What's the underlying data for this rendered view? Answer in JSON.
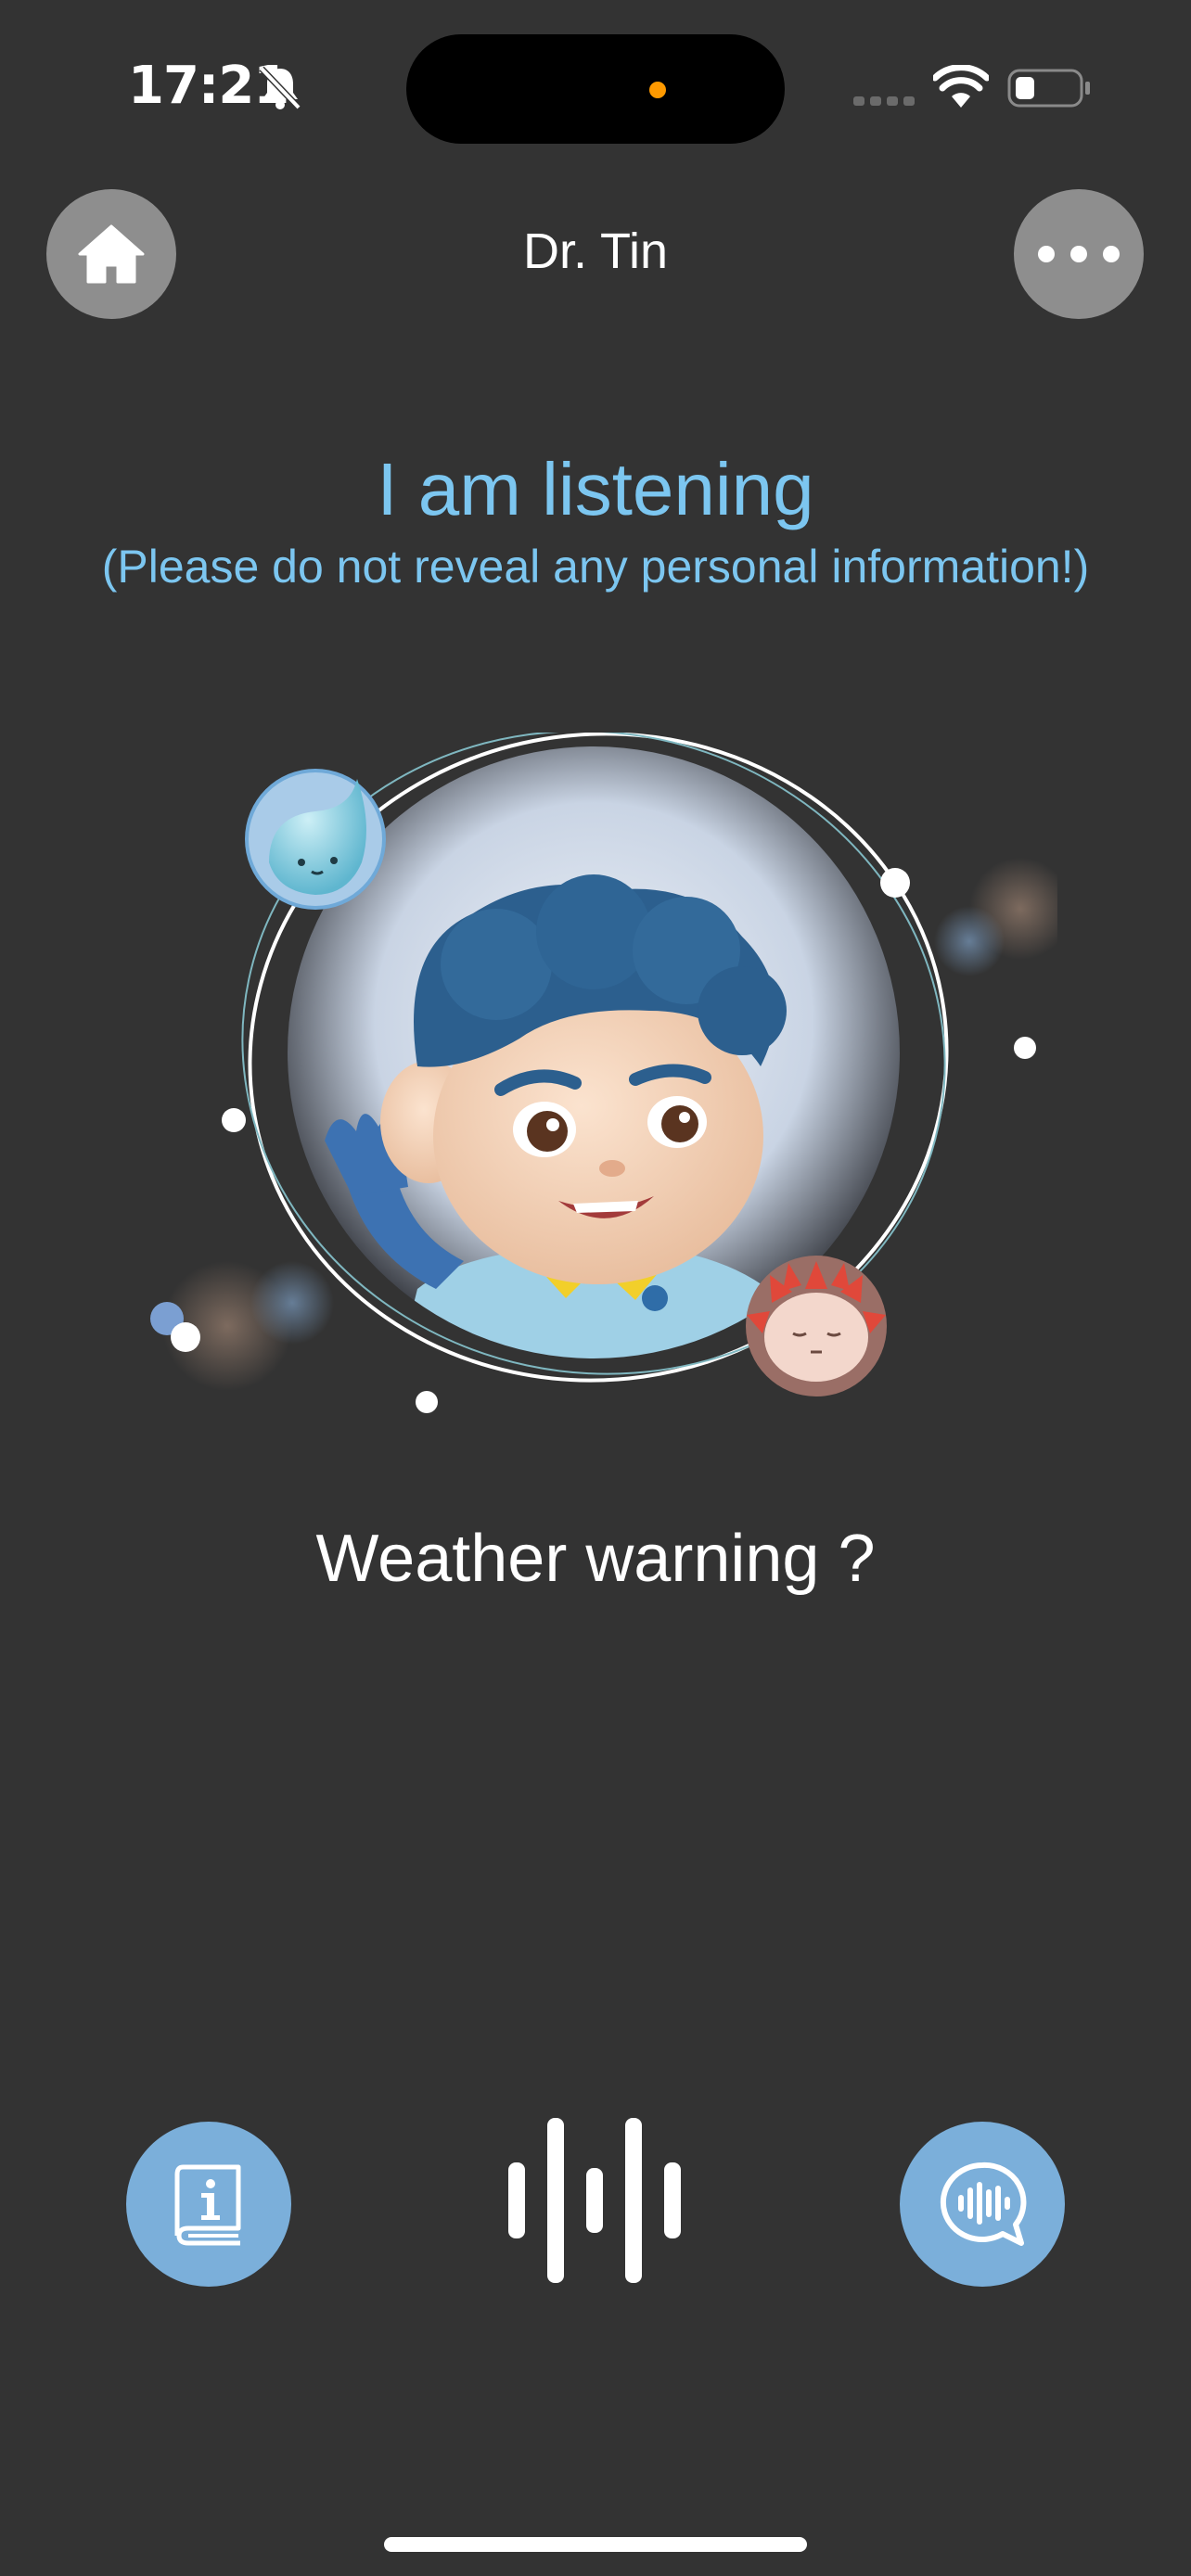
{
  "status_bar": {
    "time": "17:21"
  },
  "nav": {
    "title": "Dr. Tin",
    "home_icon": "home-icon",
    "more_icon": "more-horizontal-icon"
  },
  "listening": {
    "title": "I am listening",
    "note": "(Please do not reveal any personal information!)"
  },
  "query": {
    "text": "Weather warning ?"
  },
  "controls": {
    "left_icon": "book-info-icon",
    "center_icon": "voice-wave-icon",
    "right_icon": "chat-voice-icon"
  },
  "colors": {
    "background": "#333333",
    "accent_text": "#7cc6f0",
    "button_blue": "#7bafda",
    "button_gray": "#8e8e8e"
  }
}
